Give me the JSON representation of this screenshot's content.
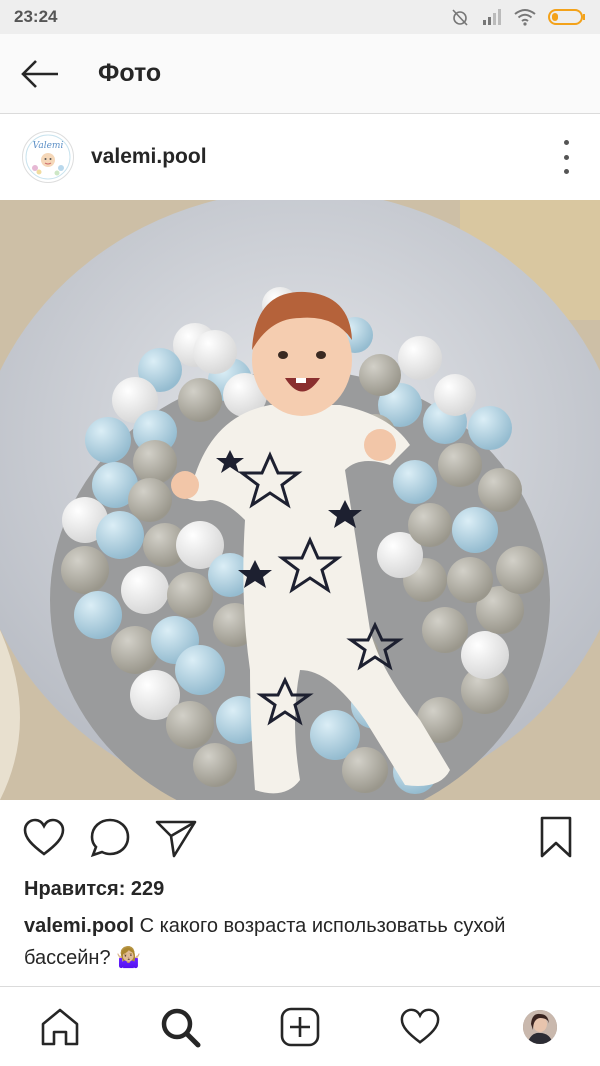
{
  "status_bar": {
    "time": "23:24"
  },
  "header": {
    "title": "Фото"
  },
  "post": {
    "username": "valemi.pool",
    "avatar_text": "Valemi",
    "likes_label": "Нравится: 229",
    "caption_username": "valemi.pool",
    "caption_text": " С какого возраста использоватьь сухой бассейн? 🤷🏼‍♀️"
  },
  "icons": {
    "back": "arrow-left-icon",
    "more": "more-vertical-icon",
    "like": "heart-icon",
    "comment": "comment-icon",
    "share": "send-icon",
    "save": "bookmark-icon",
    "home": "home-icon",
    "search": "search-icon",
    "add": "add-post-icon",
    "activity": "heart-icon",
    "profile": "profile-avatar"
  },
  "colors": {
    "text": "#262626",
    "border": "#dbdbdb",
    "status_bg": "#eeeeee",
    "battery": "#f3a21a"
  }
}
